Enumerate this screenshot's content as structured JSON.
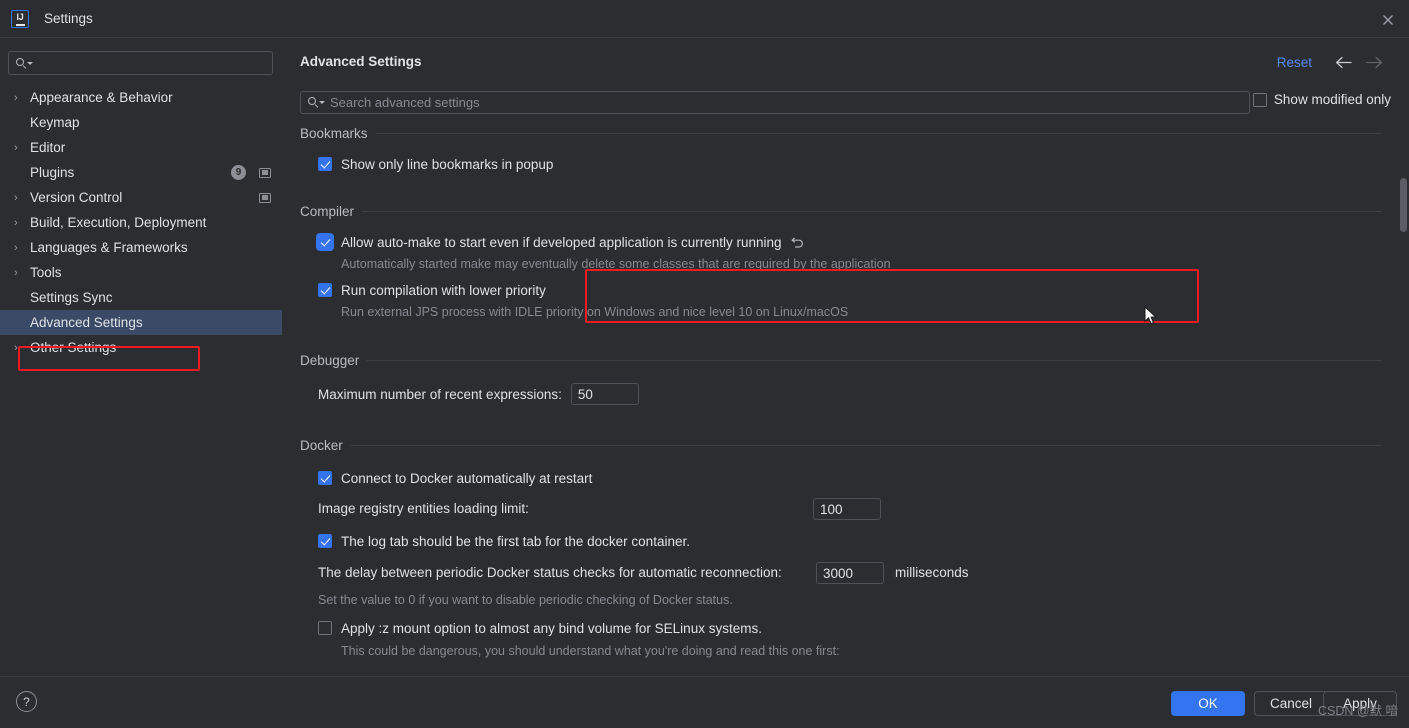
{
  "window": {
    "title": "Settings",
    "app_icon": "intellij-idea-icon",
    "close_icon": "close-icon"
  },
  "sidebar": {
    "search": {
      "placeholder": "",
      "icon": "search-icon"
    },
    "items": [
      {
        "label": "Appearance & Behavior",
        "expandable": true,
        "selected": false,
        "badge": null,
        "project_icon": false
      },
      {
        "label": "Keymap",
        "expandable": false,
        "selected": false,
        "badge": null,
        "project_icon": false
      },
      {
        "label": "Editor",
        "expandable": true,
        "selected": false,
        "badge": null,
        "project_icon": false
      },
      {
        "label": "Plugins",
        "expandable": false,
        "selected": false,
        "badge": "9",
        "project_icon": true
      },
      {
        "label": "Version Control",
        "expandable": true,
        "selected": false,
        "badge": null,
        "project_icon": true
      },
      {
        "label": "Build, Execution, Deployment",
        "expandable": true,
        "selected": false,
        "badge": null,
        "project_icon": false
      },
      {
        "label": "Languages & Frameworks",
        "expandable": true,
        "selected": false,
        "badge": null,
        "project_icon": false
      },
      {
        "label": "Tools",
        "expandable": true,
        "selected": false,
        "badge": null,
        "project_icon": false
      },
      {
        "label": "Settings Sync",
        "expandable": false,
        "selected": false,
        "badge": null,
        "project_icon": false
      },
      {
        "label": "Advanced Settings",
        "expandable": false,
        "selected": true,
        "badge": null,
        "project_icon": false
      },
      {
        "label": "Other Settings",
        "expandable": true,
        "selected": false,
        "badge": null,
        "project_icon": false
      }
    ]
  },
  "content": {
    "title": "Advanced Settings",
    "reset_label": "Reset",
    "nav_back_icon": "arrow-left-icon",
    "nav_forward_icon": "arrow-right-icon",
    "search": {
      "placeholder": "Search advanced settings",
      "value": "",
      "icon": "search-icon"
    },
    "show_modified_only": {
      "label": "Show modified only",
      "checked": false
    }
  },
  "sections": {
    "bookmarks": {
      "title": "Bookmarks",
      "opt_show_only_line": {
        "label": "Show only line bookmarks in popup",
        "checked": true
      }
    },
    "compiler": {
      "title": "Compiler",
      "opt_auto_make": {
        "label": "Allow auto-make to start even if developed application is currently running",
        "checked": true,
        "revert_icon": "revert-icon",
        "description": "Automatically started make may eventually delete some classes that are required by the application"
      },
      "opt_lower_priority": {
        "label": "Run compilation with lower priority",
        "checked": true,
        "description": "Run external JPS process with IDLE priority on Windows and nice level 10 on Linux/macOS"
      }
    },
    "debugger": {
      "title": "Debugger",
      "max_recent_expressions": {
        "label": "Maximum number of recent expressions:",
        "value": "50"
      }
    },
    "docker": {
      "title": "Docker",
      "opt_connect_restart": {
        "label": "Connect to Docker automatically at restart",
        "checked": true
      },
      "image_registry_limit": {
        "label": "Image registry entities loading limit:",
        "value": "100"
      },
      "opt_log_tab_first": {
        "label": "The log tab should be the first tab for the docker container.",
        "checked": true
      },
      "reconnect_delay": {
        "label": "The delay between periodic Docker status checks for automatic reconnection:",
        "value": "3000",
        "unit": "milliseconds",
        "description": "Set the value to 0 if you want to disable periodic checking of Docker status."
      },
      "opt_selinux_z": {
        "label": "Apply :z mount option to almost any bind volume for SELinux systems.",
        "checked": false,
        "description": "This could be dangerous, you should understand what you're doing and read this one first:"
      }
    }
  },
  "footer": {
    "help_label": "?",
    "ok_label": "OK",
    "cancel_label": "Cancel",
    "apply_label": "Apply"
  },
  "watermark": {
    "text": "CSDN @默 喑"
  },
  "colors": {
    "accent_blue": "#3574f0",
    "link_blue": "#548af7",
    "highlight_red": "#ee1c22",
    "selection_blue": "#3b4a66",
    "background": "#2b2d30"
  }
}
